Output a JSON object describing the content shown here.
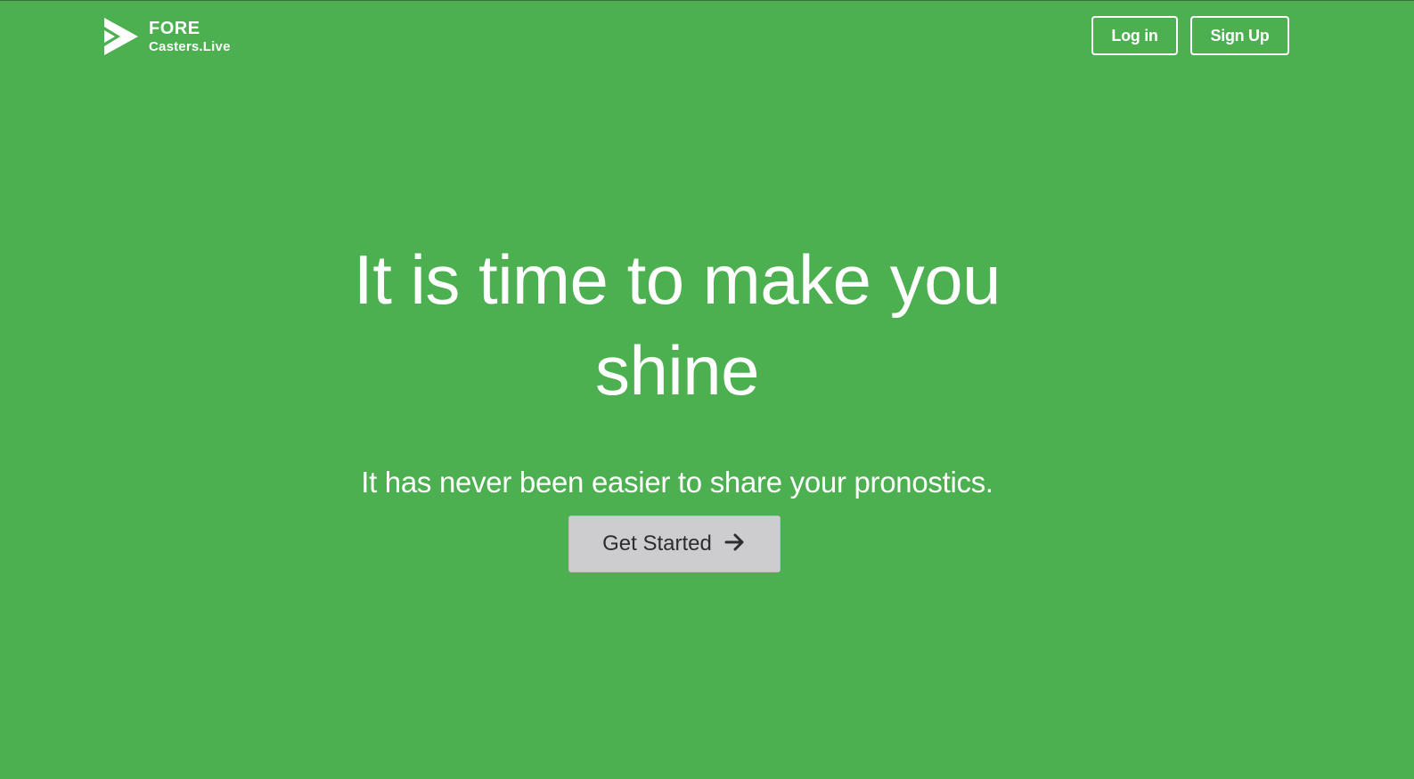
{
  "brand": {
    "line1": "FORE",
    "line2": "Casters.Live",
    "logo_icon": "play-triangle-icon"
  },
  "nav": {
    "login_label": "Log in",
    "signup_label": "Sign Up"
  },
  "hero": {
    "title": "It is time to make you shine",
    "subtitle": "It has never been easier to share your pronostics.",
    "cta_label": "Get Started",
    "cta_icon": "arrow-right-icon"
  },
  "colors": {
    "background": "#4caf50",
    "text": "#ffffff",
    "cta_bg": "#cdcdd0",
    "cta_text": "#2d2d30"
  }
}
